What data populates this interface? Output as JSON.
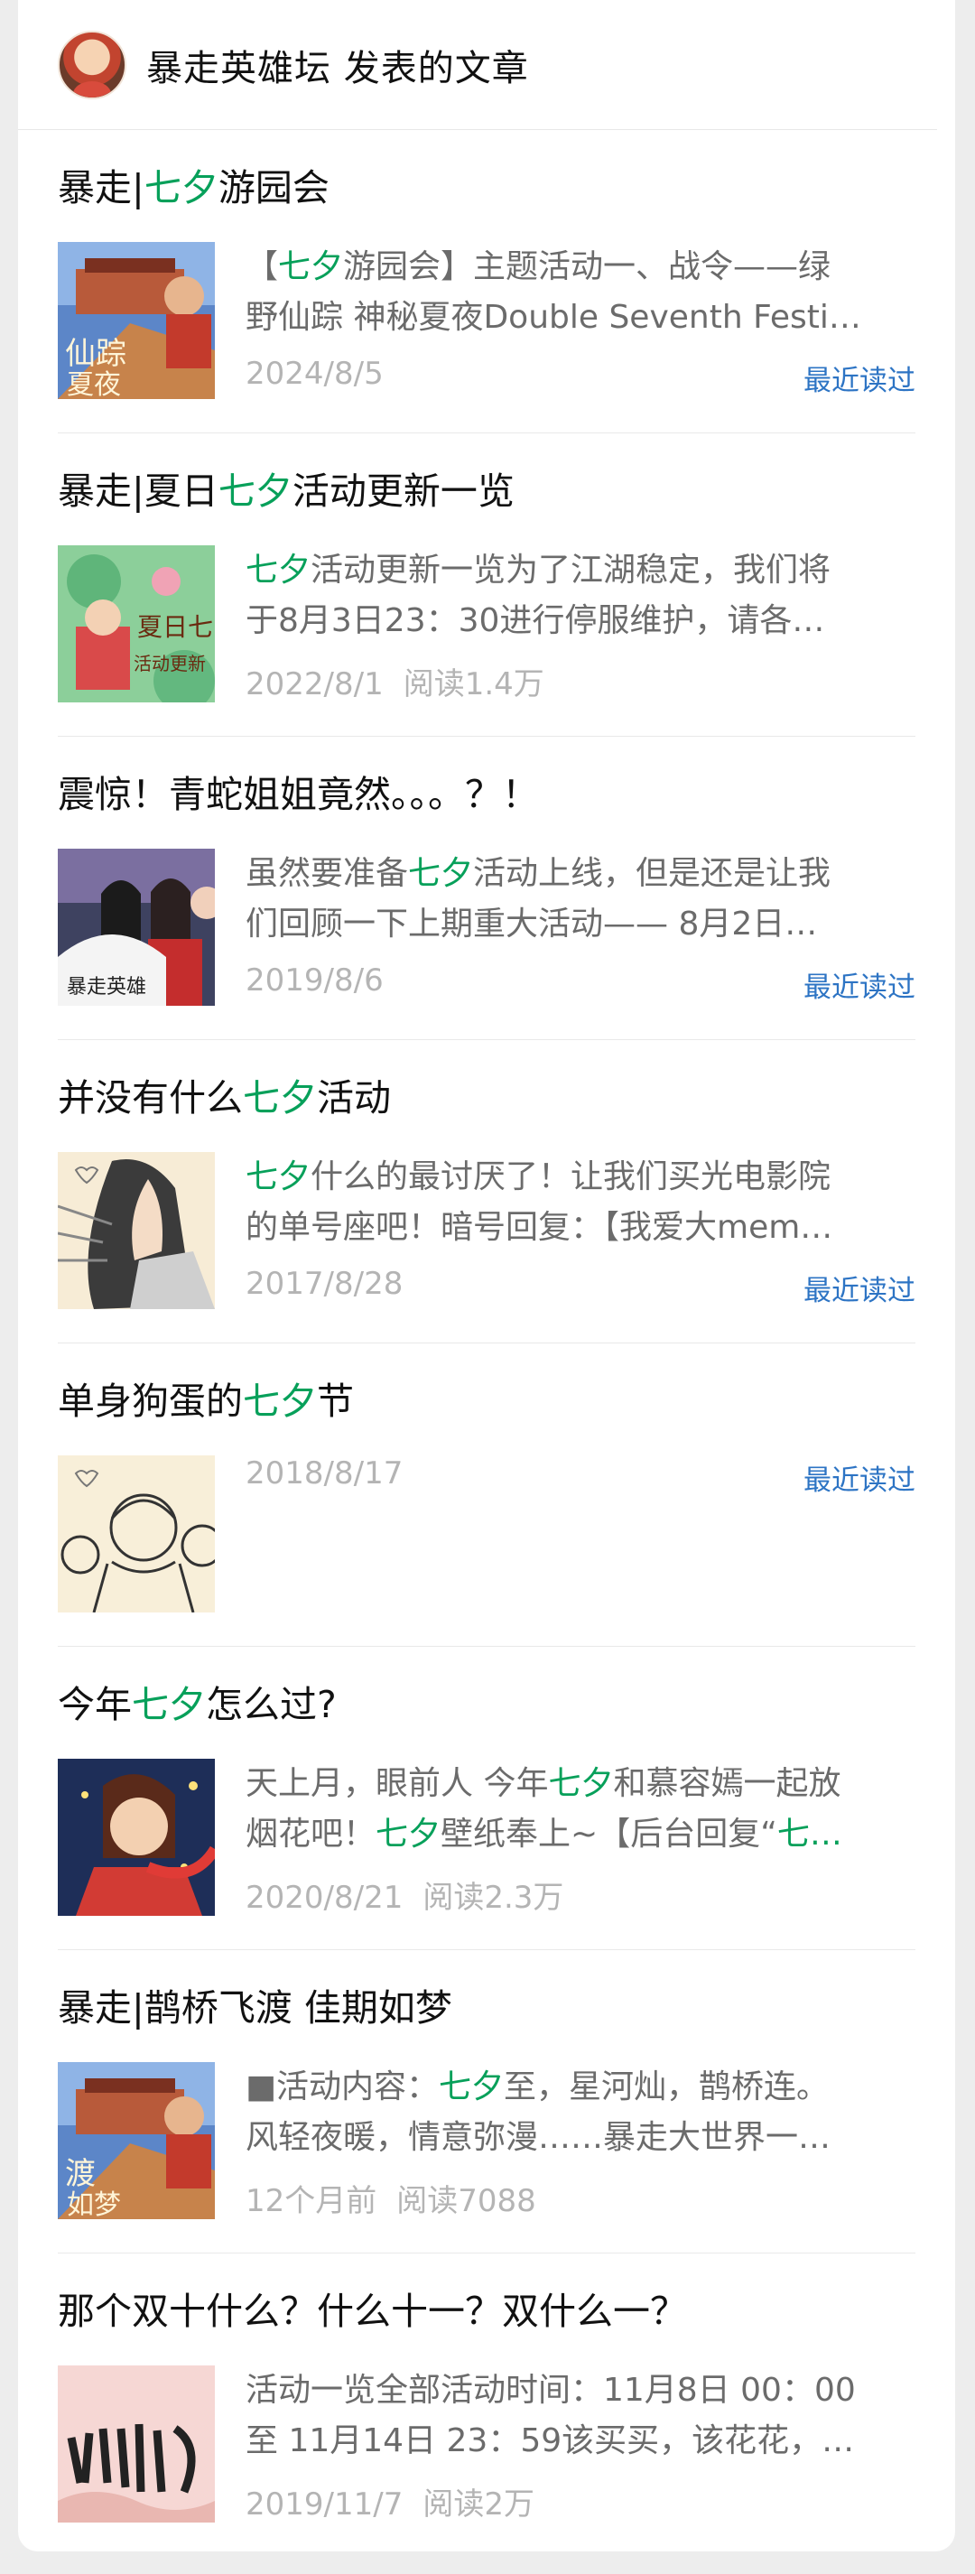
{
  "header": {
    "title": "暴走英雄坛 发表的文章"
  },
  "articles": [
    {
      "title_pre": "暴走|",
      "title_hl": "七夕",
      "title_post": "游园会",
      "snippet1_pre": "【",
      "snippet1_hl": "七夕",
      "snippet1_post": "游园会】主题活动一、战令——绿",
      "snippet2": "野仙踪 神秘夏夜Double Seventh Festi…",
      "date": "2024/8/5",
      "reads": "",
      "recent": "最近读过"
    },
    {
      "title_pre": "暴走|夏日",
      "title_hl": "七夕",
      "title_post": "活动更新一览",
      "snippet1_pre": "",
      "snippet1_hl": "七夕",
      "snippet1_post": "活动更新一览为了江湖稳定，我们将",
      "snippet2": "于8月3日23：30进行停服维护，请各…",
      "date": "2022/8/1",
      "reads": "阅读1.4万",
      "recent": ""
    },
    {
      "title_pre": "震惊！青蛇姐姐竟然。。。？！",
      "title_hl": "",
      "title_post": "",
      "snippet1_pre": "虽然要准备",
      "snippet1_hl": "七夕",
      "snippet1_post": "活动上线，但是还是让我",
      "snippet2": "们回顾一下上期重大活动—— 8月2日…",
      "date": "2019/8/6",
      "reads": "",
      "recent": "最近读过"
    },
    {
      "title_pre": "并没有什么",
      "title_hl": "七夕",
      "title_post": "活动",
      "snippet1_pre": "",
      "snippet1_hl": "七夕",
      "snippet1_post": "什么的最讨厌了！让我们买光电影院",
      "snippet2": "的单号座吧！暗号回复：【我爱大mem…",
      "date": "2017/8/28",
      "reads": "",
      "recent": "最近读过"
    },
    {
      "title_pre": "单身狗蛋的",
      "title_hl": "七夕",
      "title_post": "节",
      "snippet1_pre": "",
      "snippet1_hl": "",
      "snippet1_post": "",
      "snippet2": "",
      "date": "2018/8/17",
      "reads": "",
      "recent": "最近读过"
    },
    {
      "title_pre": "今年",
      "title_hl": "七夕",
      "title_post": "怎么过?",
      "snippet1_pre": "天上月，眼前人 今年",
      "snippet1_hl": "七夕",
      "snippet1_post": "和慕容嫣一起放",
      "snippet2_pre": "烟花吧！",
      "snippet2_hl": "七夕",
      "snippet2_mid": "壁纸奉上~【后台回复“",
      "snippet2_hl2": "七…",
      "date": "2020/8/21",
      "reads": "阅读2.3万",
      "recent": ""
    },
    {
      "title_pre": "暴走|鹊桥飞渡 佳期如梦",
      "title_hl": "",
      "title_post": "",
      "snippet1_pre": "■活动内容：",
      "snippet1_hl": "七夕",
      "snippet1_post": "至，星河灿，鹊桥连。",
      "snippet2": "风轻夜暖，情意弥漫……暴走大世界一…",
      "date": "12个月前",
      "reads": "阅读7088",
      "recent": ""
    },
    {
      "title_pre": "那个双十什么？什么十一？双什么一？",
      "title_hl": "",
      "title_post": "",
      "snippet1_pre": "活动一览全部活动时间：11月8日 00：00",
      "snippet1_hl": "",
      "snippet1_post": "",
      "snippet2": "至 11月14日 23：59该买买，该花花，…",
      "date": "2019/11/7",
      "reads": "阅读2万",
      "recent": ""
    }
  ]
}
